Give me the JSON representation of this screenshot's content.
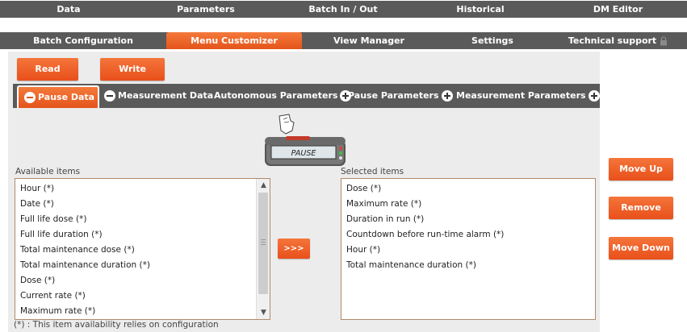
{
  "nav": {
    "row1": [
      {
        "label": "Data"
      },
      {
        "label": "Parameters"
      },
      {
        "label": "Batch In / Out"
      },
      {
        "label": "Historical"
      },
      {
        "label": "DM Editor"
      }
    ],
    "row2": [
      {
        "label": "Batch Configuration"
      },
      {
        "label": "Menu Customizer",
        "active": true
      },
      {
        "label": "View Manager"
      },
      {
        "label": "Settings"
      },
      {
        "label": "Technical support",
        "icon": "lock-icon"
      }
    ]
  },
  "toolbar": {
    "read_label": "Read",
    "write_label": "Write"
  },
  "tabs": [
    {
      "label": "Pause Data",
      "icon": "minus-circle-icon",
      "active": true
    },
    {
      "label": "Measurement Data",
      "icon": "minus-circle-icon"
    },
    {
      "label": "Autonomous Parameters",
      "icon": "plus-circle-icon"
    },
    {
      "label": "Pause Parameters",
      "icon": "plus-circle-icon"
    },
    {
      "label": "Measurement Parameters",
      "icon": "plus-circle-icon"
    }
  ],
  "device": {
    "screen_text": "PAUSE",
    "icon": "pager-device-icon"
  },
  "available": {
    "label": "Available items",
    "items": [
      "Hour (*)",
      "Date (*)",
      "Full life dose (*)",
      "Full life duration (*)",
      "Total maintenance dose (*)",
      "Total maintenance duration (*)",
      "Dose (*)",
      "Current rate (*)",
      "Maximum rate (*)"
    ]
  },
  "selected": {
    "label": "Selected items",
    "items": [
      "Dose (*)",
      "Maximum rate (*)",
      "Duration in run (*)",
      "Countdown before run-time alarm (*)",
      "Hour (*)",
      "Total maintenance duration (*)"
    ]
  },
  "actions": {
    "transfer_label": ">>>",
    "move_up_label": "Move Up",
    "remove_label": "Remove",
    "move_down_label": "Move Down"
  },
  "footnote": "(*) : This item availability relies on configuration",
  "colors": {
    "accent": "#e9541c",
    "nav_bg": "#5a5a5a",
    "panel_bg": "#ececec"
  }
}
